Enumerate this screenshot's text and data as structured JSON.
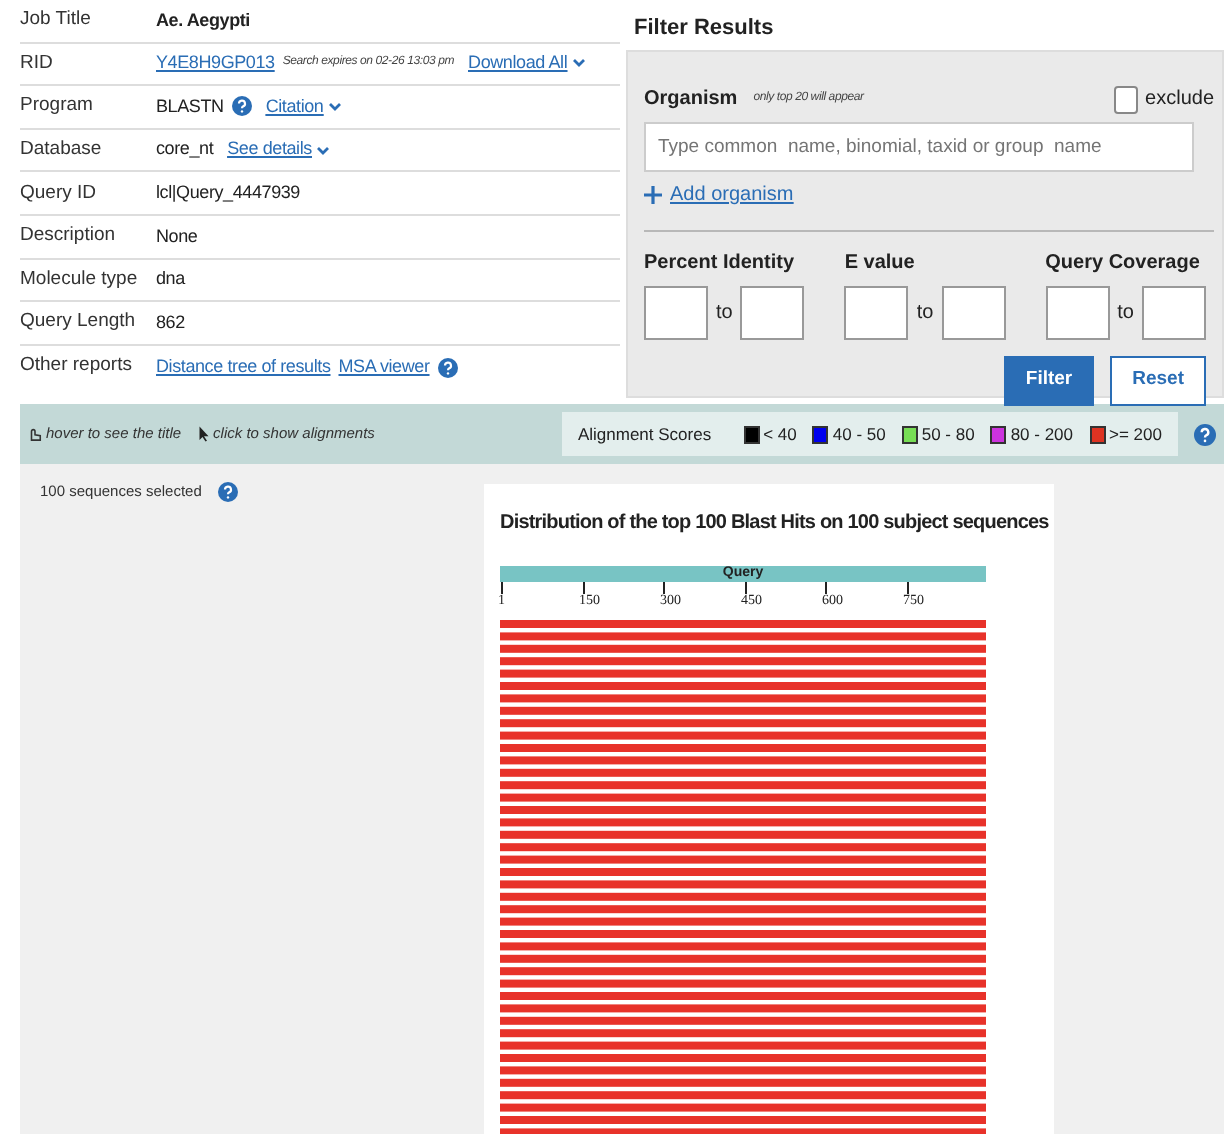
{
  "summary": {
    "rows": [
      {
        "label": "Job Title",
        "parts": [
          {
            "kind": "bold",
            "text": "Ae. Aegypti"
          }
        ]
      },
      {
        "label": "RID",
        "parts": [
          {
            "kind": "link",
            "text": "Y4E8H9GP013"
          },
          {
            "kind": "note",
            "text": "Search expires on 02-26 13:03 pm"
          },
          {
            "kind": "dropdown",
            "text": "Download All"
          }
        ]
      },
      {
        "label": "Program",
        "parts": [
          {
            "kind": "text",
            "text": "BLASTN"
          },
          {
            "kind": "help"
          },
          {
            "kind": "dropdown",
            "text": "Citation"
          }
        ]
      },
      {
        "label": "Database",
        "parts": [
          {
            "kind": "text",
            "text": "core_nt"
          },
          {
            "kind": "dropdown",
            "text": "See details"
          }
        ]
      },
      {
        "label": "Query ID",
        "parts": [
          {
            "kind": "text",
            "text": "lcl|Query_4447939"
          }
        ]
      },
      {
        "label": "Description",
        "parts": [
          {
            "kind": "text",
            "text": "None"
          }
        ]
      },
      {
        "label": "Molecule type",
        "parts": [
          {
            "kind": "text",
            "text": "dna"
          }
        ]
      },
      {
        "label": "Query Length",
        "parts": [
          {
            "kind": "text",
            "text": "862"
          }
        ]
      },
      {
        "label": "Other reports",
        "parts": [
          {
            "kind": "link",
            "text": "Distance tree of results"
          },
          {
            "kind": "link",
            "text": "MSA viewer"
          },
          {
            "kind": "help"
          }
        ]
      }
    ]
  },
  "filter": {
    "title": "Filter Results",
    "organism_label": "Organism",
    "organism_note": "only top 20 will appear",
    "exclude": {
      "label": "exclude",
      "checked": false
    },
    "organism_field": {
      "placeholder": "Type common  name, binomial, taxid or group  name"
    },
    "add_link": "Add organism",
    "ranges": [
      {
        "label": "Percent Identity",
        "to": "to"
      },
      {
        "label": "E value",
        "to": "to"
      },
      {
        "label": "Query Coverage",
        "to": "to"
      }
    ],
    "buttons": [
      {
        "label": "Filter",
        "kind": "primary"
      },
      {
        "label": "Reset",
        "kind": "secondary"
      }
    ]
  },
  "toolbar": {
    "hints": [
      {
        "kind": "hover",
        "text": "hover to see the title"
      },
      {
        "kind": "click",
        "text": "click to show alignments"
      }
    ],
    "legend_title": "Alignment Scores",
    "legend": [
      {
        "label": "< 40",
        "color": "#000000"
      },
      {
        "label": "40 - 50",
        "color": "#0000ee"
      },
      {
        "label": "50 - 80",
        "color": "#77dd55"
      },
      {
        "label": "80 - 200",
        "color": "#cc33dd"
      },
      {
        "label": ">= 200",
        "color": "#dd3322"
      }
    ]
  },
  "selection": {
    "text": "100 sequences selected"
  },
  "graphic": {
    "title": "Distribution of the top 100 Blast Hits on 100 subject sequences",
    "query_label": "Query",
    "ticks": [
      "1",
      "150",
      "300",
      "450",
      "600",
      "750"
    ]
  }
}
